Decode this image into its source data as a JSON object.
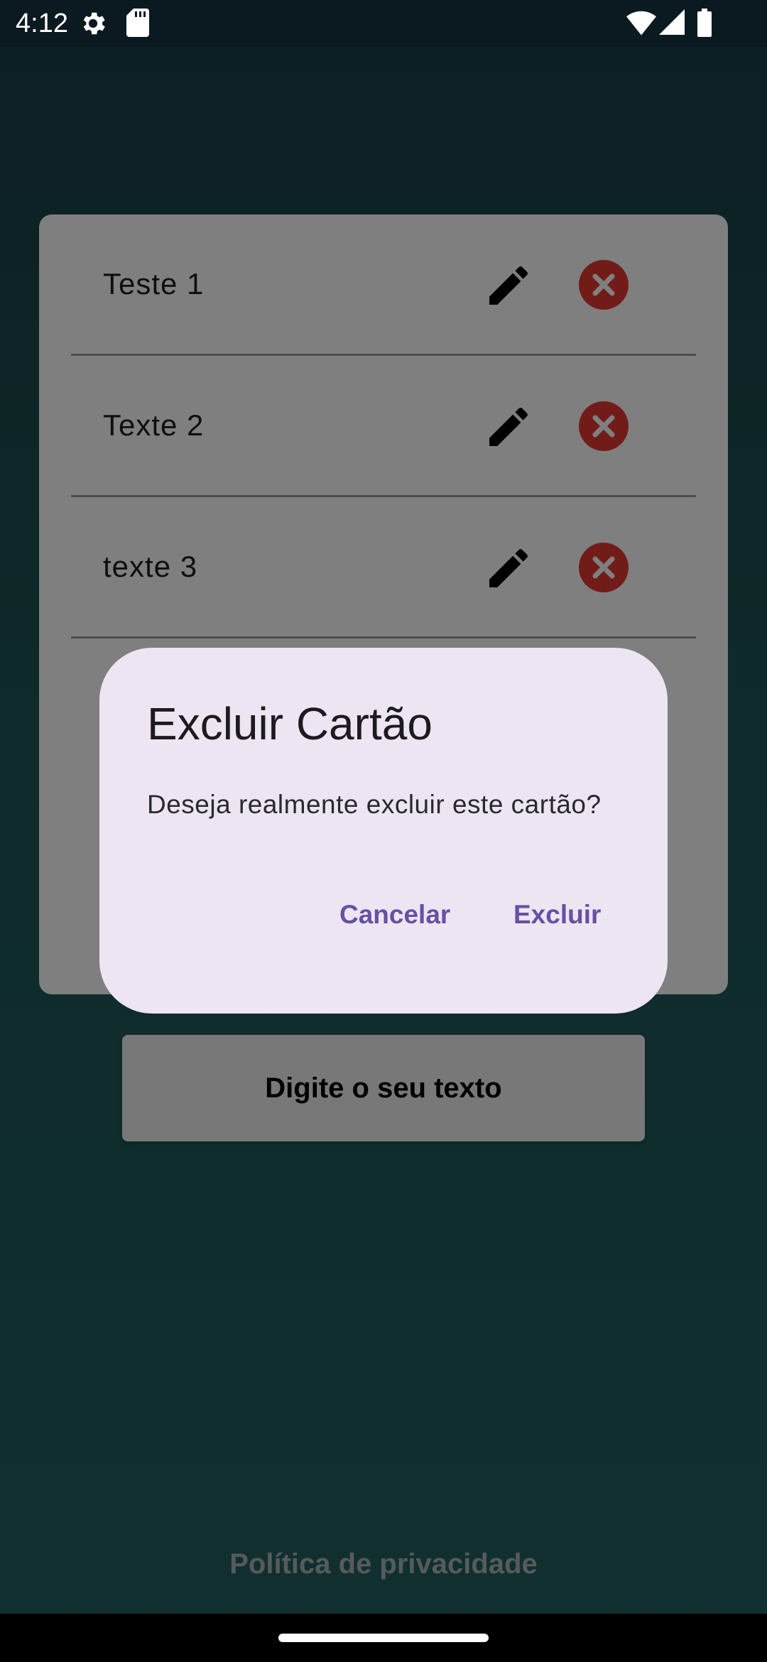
{
  "status_bar": {
    "time": "4:12",
    "icons": [
      "settings-icon",
      "sd-card-icon",
      "wifi-icon",
      "signal-icon",
      "battery-icon"
    ]
  },
  "cards": [
    {
      "label": "Teste 1"
    },
    {
      "label": "Texte 2"
    },
    {
      "label": "texte 3"
    }
  ],
  "main_button": {
    "label": "Digite o seu texto"
  },
  "privacy_link": {
    "label": "Política de privacidade"
  },
  "dialog": {
    "title": "Excluir Cartão",
    "message": "Deseja realmente excluir este cartão?",
    "cancel_label": "Cancelar",
    "confirm_label": "Excluir"
  },
  "colors": {
    "accent": "#6750a4",
    "delete": "#e53935",
    "dialog_bg": "#ede6f2"
  }
}
